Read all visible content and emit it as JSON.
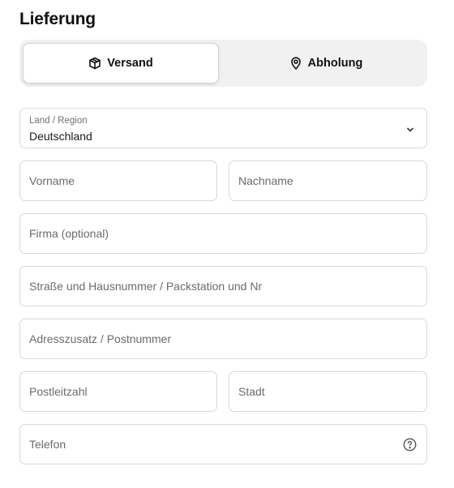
{
  "section": {
    "title": "Lieferung"
  },
  "delivery_method": {
    "options": [
      {
        "label": "Versand",
        "icon": "package-icon",
        "selected": true
      },
      {
        "label": "Abholung",
        "icon": "location-pin-icon",
        "selected": false
      }
    ]
  },
  "form": {
    "country": {
      "label": "Land / Region",
      "value": "Deutschland",
      "icon": "chevron-down-icon"
    },
    "first_name": {
      "placeholder": "Vorname"
    },
    "last_name": {
      "placeholder": "Nachname"
    },
    "company": {
      "placeholder": "Firma (optional)"
    },
    "street": {
      "placeholder": "Straße und Hausnummer / Packstation und Nr"
    },
    "address_extra": {
      "placeholder": "Adresszusatz / Postnummer"
    },
    "postal_code": {
      "placeholder": "Postleitzahl"
    },
    "city": {
      "placeholder": "Stadt"
    },
    "phone": {
      "placeholder": "Telefon",
      "icon": "help-circle-icon"
    }
  },
  "colors": {
    "text": "#111111",
    "placeholder": "#6b6b6b",
    "border": "#d9d9d9",
    "toggle_background": "#f1f1f1"
  }
}
